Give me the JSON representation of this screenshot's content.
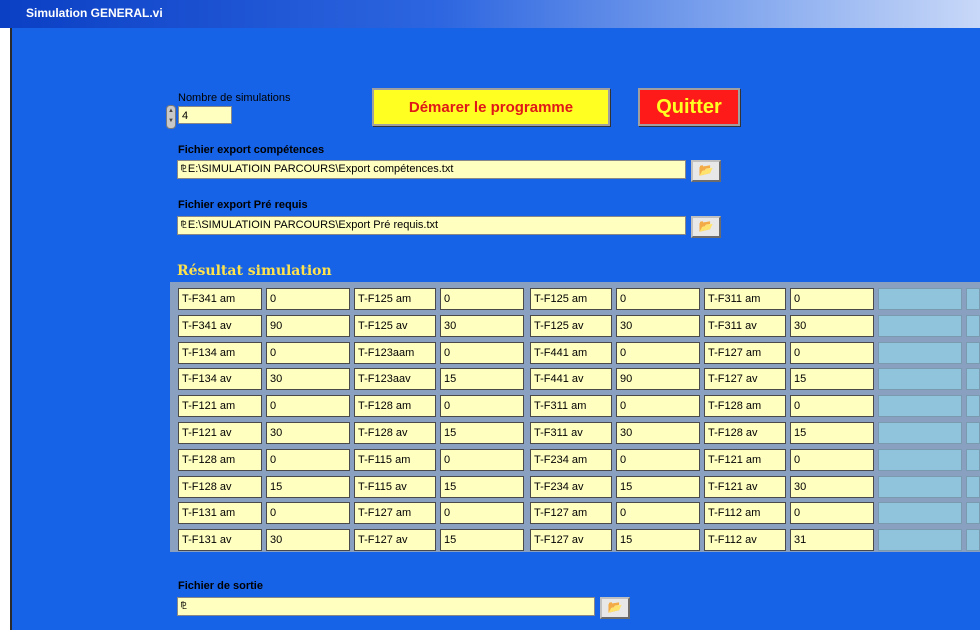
{
  "window": {
    "title": "Simulation GENERAL.vi"
  },
  "simulations": {
    "label": "Nombre de simulations",
    "value": "4",
    "stepper": "up-down-arrows-icon"
  },
  "buttons": {
    "start": "Démarer le programme",
    "quit": "Quitter"
  },
  "export_competences": {
    "label": "Fichier export compétences",
    "value": "E:\\SIMULATIOIN PARCOURS\\Export compétences.txt"
  },
  "export_prerequis": {
    "label": "Fichier export Pré requis",
    "value": "E:\\SIMULATIOIN PARCOURS\\Export Pré requis.txt"
  },
  "output_file": {
    "label": "Fichier de sortie",
    "value": ""
  },
  "icons": {
    "path": "path-prefix-icon",
    "browse": "folder-browse-icon"
  },
  "results": {
    "label": "Résultat simulation",
    "rows": [
      [
        "T-F341 am",
        "0",
        "T-F125 am",
        "0",
        "T-F125 am",
        "0",
        "T-F311 am",
        "0"
      ],
      [
        "T-F341 av",
        "90",
        "T-F125 av",
        "30",
        "T-F125 av",
        "30",
        "T-F311 av",
        "30"
      ],
      [
        "T-F134 am",
        "0",
        "T-F123aam",
        "0",
        "T-F441 am",
        "0",
        "T-F127 am",
        "0"
      ],
      [
        "T-F134 av",
        "30",
        "T-F123aav",
        "15",
        "T-F441 av",
        "90",
        "T-F127 av",
        "15"
      ],
      [
        "T-F121 am",
        "0",
        "T-F128 am",
        "0",
        "T-F311 am",
        "0",
        "T-F128 am",
        "0"
      ],
      [
        "T-F121 av",
        "30",
        "T-F128 av",
        "15",
        "T-F311 av",
        "30",
        "T-F128 av",
        "15"
      ],
      [
        "T-F128 am",
        "0",
        "T-F115 am",
        "0",
        "T-F234 am",
        "0",
        "T-F121 am",
        "0"
      ],
      [
        "T-F128 av",
        "15",
        "T-F115 av",
        "15",
        "T-F234 av",
        "15",
        "T-F121 av",
        "30"
      ],
      [
        "T-F131 am",
        "0",
        "T-F127 am",
        "0",
        "T-F127 am",
        "0",
        "T-F112 am",
        "0"
      ],
      [
        "T-F131 av",
        "30",
        "T-F127 av",
        "15",
        "T-F127 av",
        "15",
        "T-F112 av",
        "31"
      ]
    ]
  },
  "colors": {
    "panel": "#1663e8",
    "field": "#ffffc0",
    "start_button": "#ffff22",
    "quit_button": "#ff1a1a",
    "result_label": "#ffe34d"
  }
}
